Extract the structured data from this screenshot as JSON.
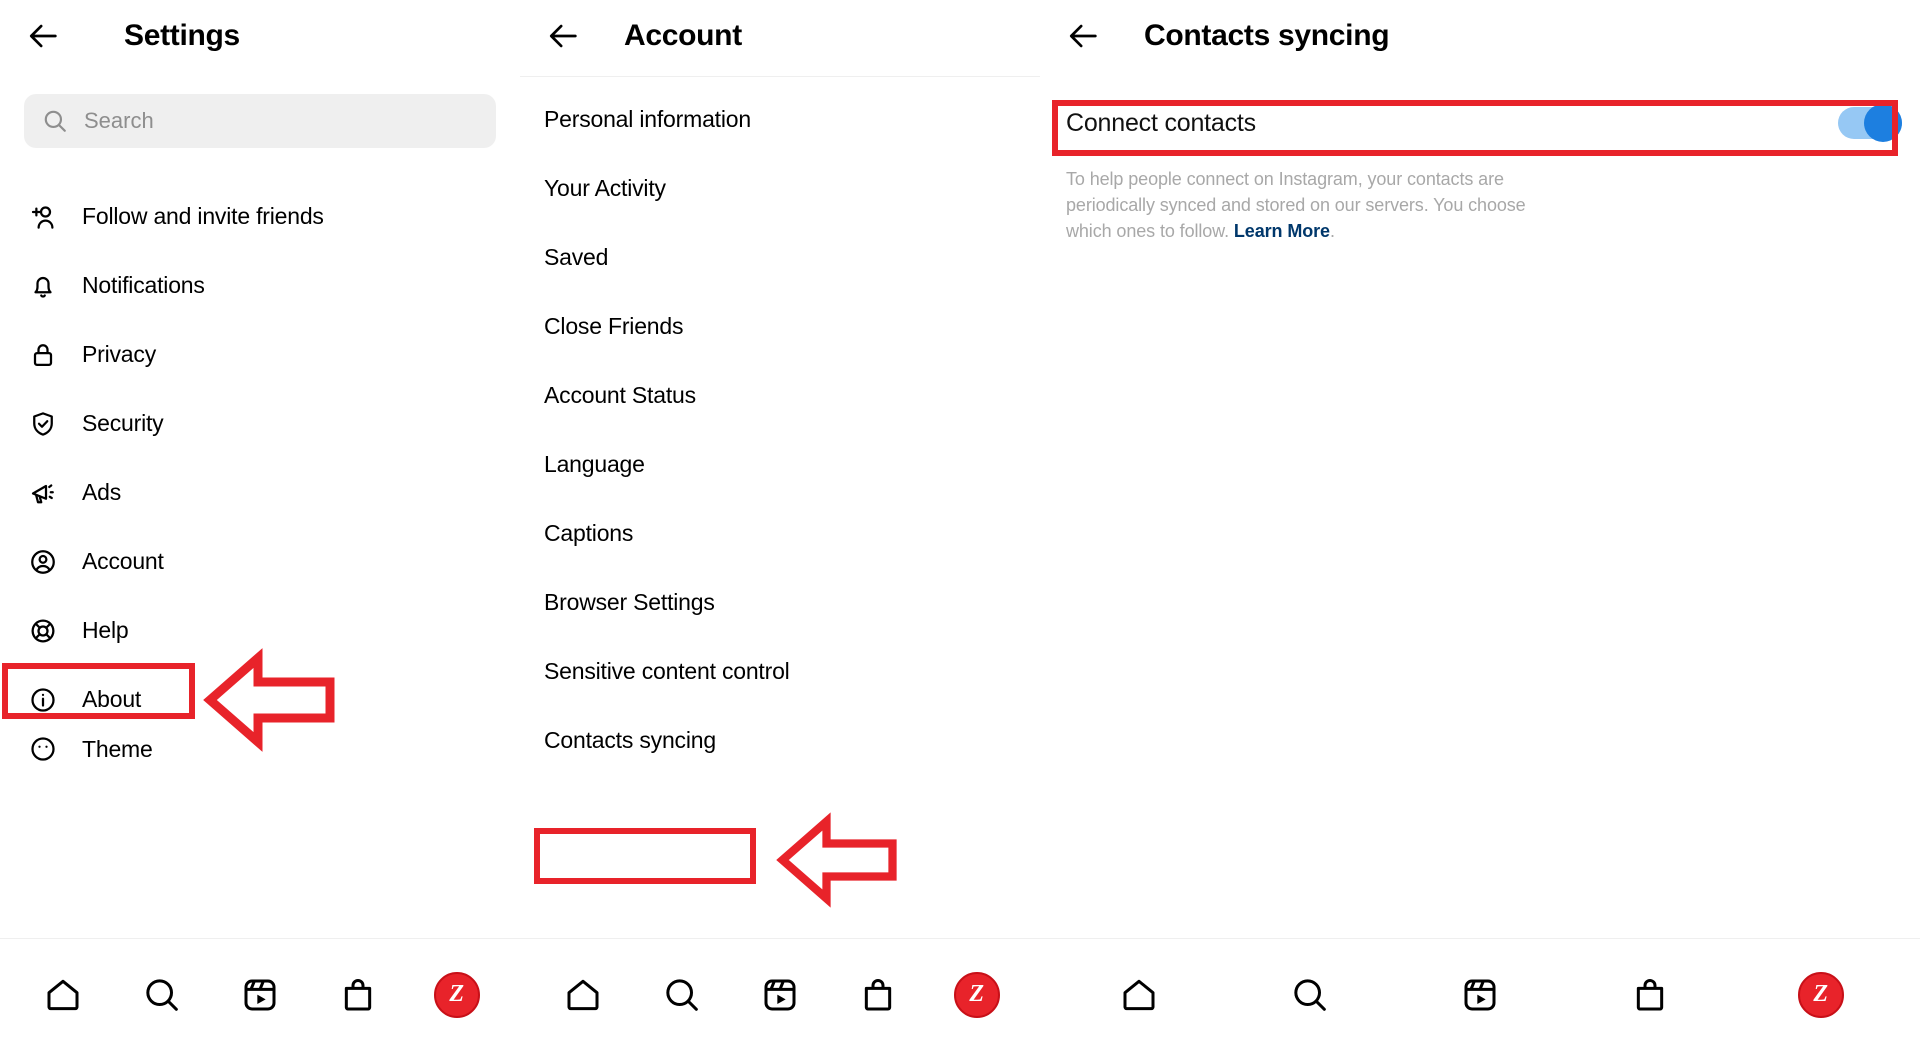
{
  "panels": {
    "settings": {
      "title": "Settings",
      "back_icon": "arrow-left-icon",
      "search": {
        "placeholder": "Search",
        "icon": "search-icon"
      },
      "items": [
        {
          "label": "Follow and invite friends",
          "icon": "person-add-icon"
        },
        {
          "label": "Notifications",
          "icon": "bell-icon"
        },
        {
          "label": "Privacy",
          "icon": "lock-icon"
        },
        {
          "label": "Security",
          "icon": "shield-check-icon"
        },
        {
          "label": "Ads",
          "icon": "megaphone-icon"
        },
        {
          "label": "Account",
          "icon": "account-circle-icon"
        },
        {
          "label": "Help",
          "icon": "lifebuoy-icon"
        },
        {
          "label": "About",
          "icon": "info-circle-icon"
        },
        {
          "label": "Theme",
          "icon": "face-icon"
        }
      ],
      "highlight": "Account",
      "annotation_color": "#e8232a"
    },
    "account": {
      "title": "Account",
      "back_icon": "arrow-left-icon",
      "items": [
        {
          "label": "Personal information"
        },
        {
          "label": "Your Activity"
        },
        {
          "label": "Saved"
        },
        {
          "label": "Close Friends"
        },
        {
          "label": "Account Status"
        },
        {
          "label": "Language"
        },
        {
          "label": "Captions"
        },
        {
          "label": "Browser Settings"
        },
        {
          "label": "Sensitive content control"
        },
        {
          "label": "Contacts syncing"
        }
      ],
      "highlight": "Contacts syncing",
      "annotation_color": "#e8232a"
    },
    "contacts_syncing": {
      "title": "Contacts syncing",
      "back_icon": "arrow-left-icon",
      "toggle": {
        "label": "Connect contacts",
        "state": "on",
        "track_color": "#96c8f4",
        "knob_color": "#1d7fe0"
      },
      "description": "To help people connect on Instagram, your contacts are periodically synced and stored on our servers. You choose which ones to follow.",
      "learn_more": "Learn More",
      "learn_more_color": "#00376b",
      "highlight": "Connect contacts",
      "annotation_color": "#e8232a"
    }
  },
  "bottom_nav": {
    "items": [
      {
        "name": "home-icon"
      },
      {
        "name": "search-icon"
      },
      {
        "name": "reels-icon"
      },
      {
        "name": "shop-bag-icon"
      },
      {
        "name": "profile-avatar"
      }
    ],
    "avatar_letter": "Z",
    "avatar_color": "#e8232a"
  }
}
